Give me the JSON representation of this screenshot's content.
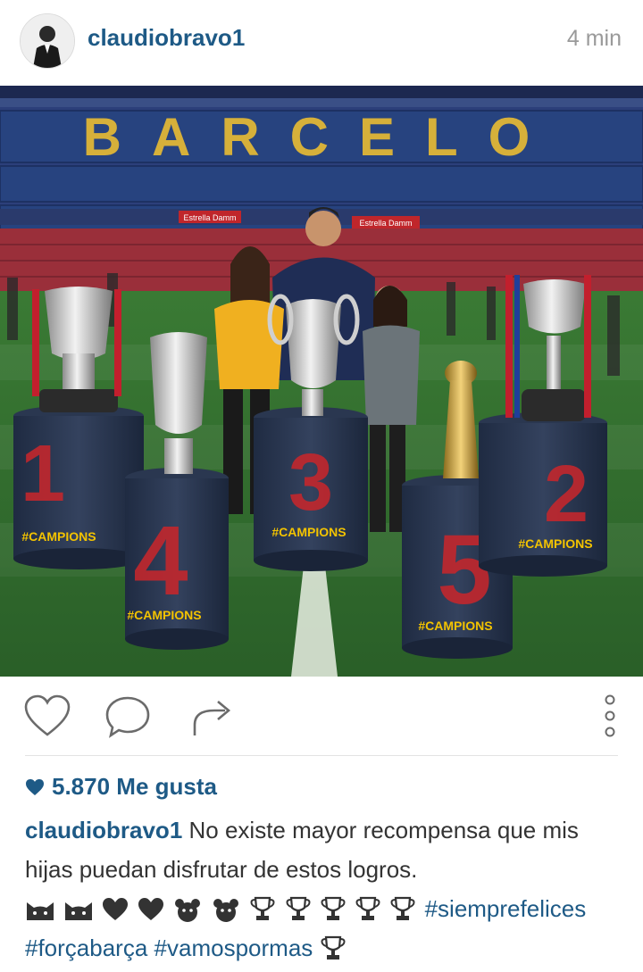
{
  "post": {
    "username": "claudiobravo1",
    "time_ago": "4 min"
  },
  "photo": {
    "stadium_text": "BARCELO",
    "sponsor": "Estrella Damm",
    "trophy_label": "#CAMPIONS",
    "trophy_numbers": [
      "1",
      "4",
      "3",
      "5",
      "2"
    ]
  },
  "likes": {
    "count_text": "5.870 Me gusta"
  },
  "caption": {
    "username": "claudiobravo1",
    "text": " No existe mayor recompensa que mis hijas puedan disfrutar de estos logros.",
    "hashtag1": "#siemprefelices",
    "hashtag2": "#forçabarça",
    "hashtag3": "#vamospormas"
  },
  "icons": {
    "like": "heart-outline-icon",
    "comment": "comment-bubble-icon",
    "share": "share-arrow-icon",
    "more": "more-vertical-icon"
  },
  "colors": {
    "link": "#1e5a86",
    "trophy_box": "#233048",
    "trophy_number": "#c2272d",
    "grass": "#2f6e2f"
  }
}
